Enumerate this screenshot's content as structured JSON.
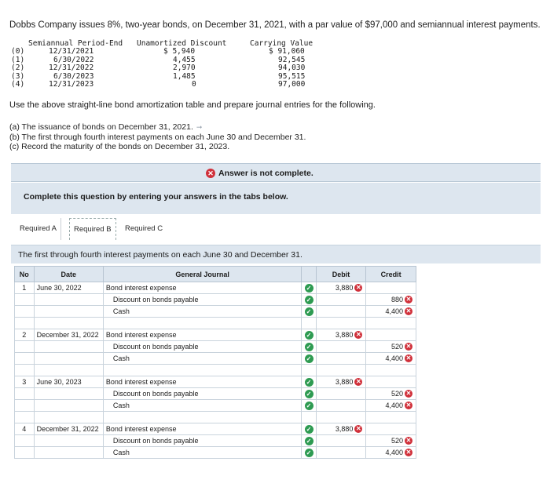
{
  "problem": "Dobbs Company issues 8%, two-year bonds, on December 31, 2021, with a par value of $97,000 and semiannual interest payments.",
  "amortization": {
    "headers": [
      "Semiannual Period-End",
      "Unamortized Discount",
      "Carrying Value"
    ],
    "rows": [
      {
        "period": "(0)",
        "date": "12/31/2021",
        "discount": "$ 5,940",
        "carrying": "$ 91,060"
      },
      {
        "period": "(1)",
        "date": "6/30/2022",
        "discount": "4,455",
        "carrying": "92,545"
      },
      {
        "period": "(2)",
        "date": "12/31/2022",
        "discount": "2,970",
        "carrying": "94,030"
      },
      {
        "period": "(3)",
        "date": "6/30/2023",
        "discount": "1,485",
        "carrying": "95,515"
      },
      {
        "period": "(4)",
        "date": "12/31/2023",
        "discount": "0",
        "carrying": "97,000"
      }
    ]
  },
  "instruction": "Use the above straight-line bond amortization table and prepare journal entries for the following.",
  "parts": [
    "(a) The issuance of bonds on December 31, 2021.",
    "(b) The first through fourth interest payments on each June 30 and December 31.",
    "(c) Record the maturity of the bonds on December 31, 2023."
  ],
  "banner": "Answer is not complete.",
  "complete_text": "Complete this question by entering your answers in the tabs below.",
  "tabs": [
    "Required A",
    "Required B",
    "Required C"
  ],
  "subheading": "The first through fourth interest payments on each June 30 and December 31.",
  "journal": {
    "headers": {
      "no": "No",
      "date": "Date",
      "gj": "General Journal",
      "debit": "Debit",
      "credit": "Credit"
    },
    "entries": [
      {
        "no": "1",
        "date": "June 30, 2022",
        "lines": [
          {
            "acct": "Bond interest expense",
            "debit": "3,880",
            "credit": ""
          },
          {
            "acct": "Discount on bonds payable",
            "debit": "",
            "credit": "880"
          },
          {
            "acct": "Cash",
            "debit": "",
            "credit": "4,400"
          }
        ]
      },
      {
        "no": "2",
        "date": "December 31, 2022",
        "lines": [
          {
            "acct": "Bond interest expense",
            "debit": "3,880",
            "credit": ""
          },
          {
            "acct": "Discount on bonds payable",
            "debit": "",
            "credit": "520"
          },
          {
            "acct": "Cash",
            "debit": "",
            "credit": "4,400"
          }
        ]
      },
      {
        "no": "3",
        "date": "June 30, 2023",
        "lines": [
          {
            "acct": "Bond interest expense",
            "debit": "3,880",
            "credit": ""
          },
          {
            "acct": "Discount on bonds payable",
            "debit": "",
            "credit": "520"
          },
          {
            "acct": "Cash",
            "debit": "",
            "credit": "4,400"
          }
        ]
      },
      {
        "no": "4",
        "date": "December 31, 2022",
        "lines": [
          {
            "acct": "Bond interest expense",
            "debit": "3,880",
            "credit": ""
          },
          {
            "acct": "Discount on bonds payable",
            "debit": "",
            "credit": "520"
          },
          {
            "acct": "Cash",
            "debit": "",
            "credit": "4,400"
          }
        ]
      }
    ]
  },
  "colors": {
    "panel": "#dde6ef",
    "error": "#d0303a",
    "ok": "#2e9b52"
  }
}
